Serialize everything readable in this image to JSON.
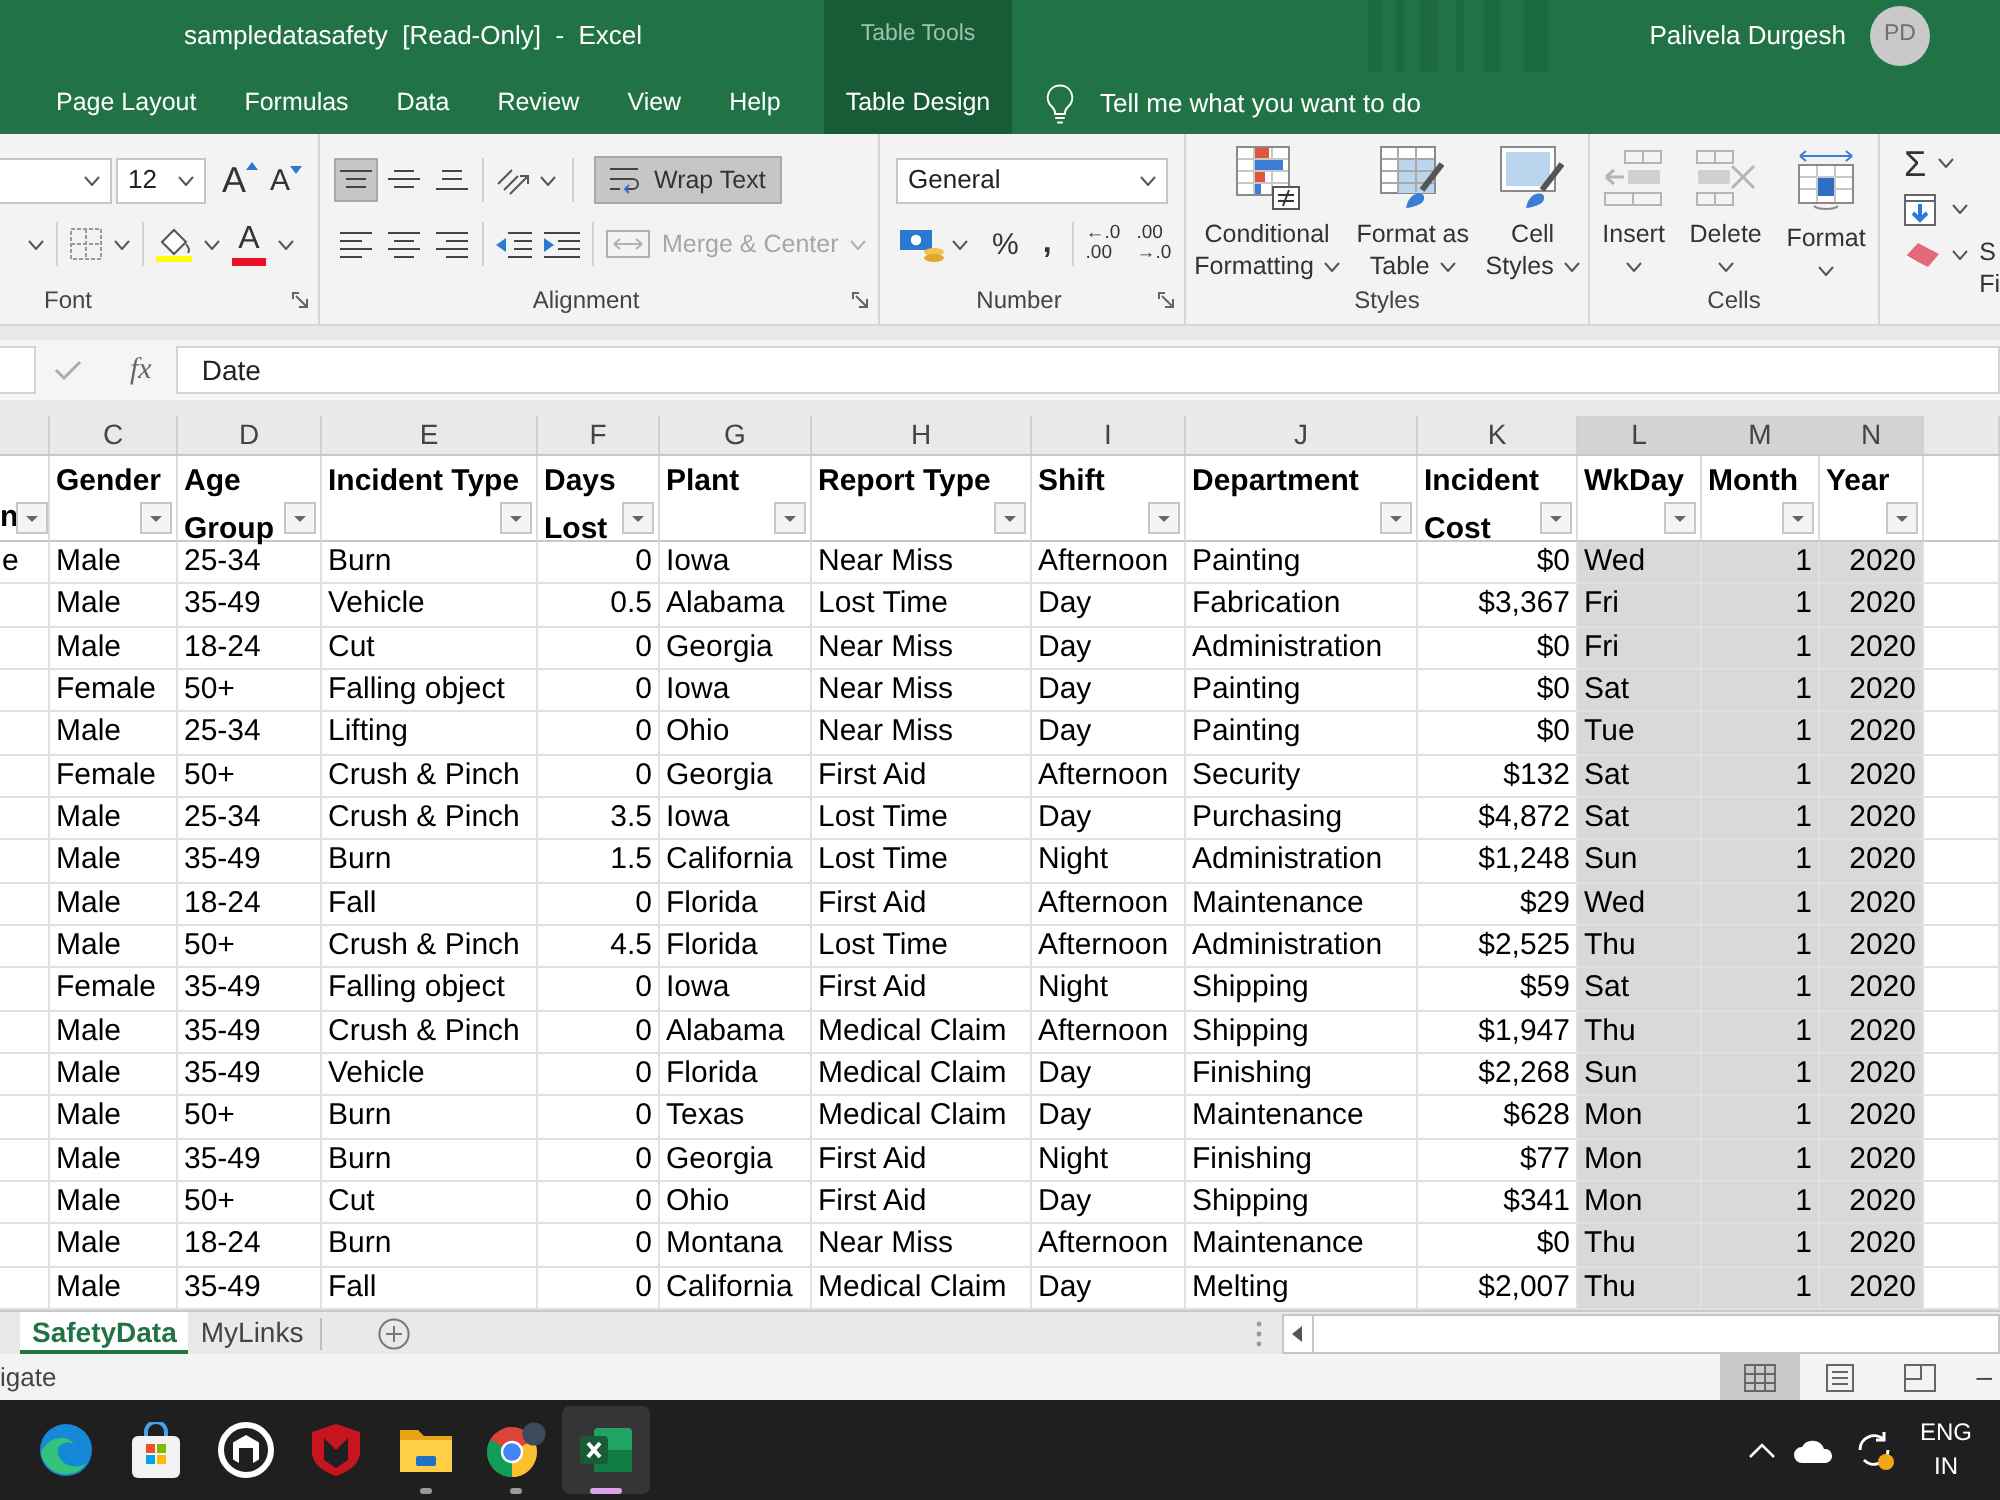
{
  "window": {
    "title": "sampledatasafety  [Read-Only]  -  Excel",
    "context_group": "Table Tools",
    "user_name": "Palivela Durgesh",
    "user_initials": "PD"
  },
  "ribbon_tabs": [
    {
      "label": "Page Layout",
      "selected": false,
      "kind": "standard"
    },
    {
      "label": "Formulas",
      "selected": false,
      "kind": "standard"
    },
    {
      "label": "Data",
      "selected": false,
      "kind": "standard"
    },
    {
      "label": "Review",
      "selected": false,
      "kind": "standard"
    },
    {
      "label": "View",
      "selected": false,
      "kind": "standard"
    },
    {
      "label": "Help",
      "selected": false,
      "kind": "standard"
    },
    {
      "label": "Table Design",
      "selected": false,
      "kind": "contextual"
    }
  ],
  "tell_me": {
    "placeholder": "Tell me what you want to do"
  },
  "font_group": {
    "label": "Font",
    "font_size": "12",
    "grow_font": "A",
    "shrink_font": "A",
    "font_color": "A"
  },
  "alignment_group": {
    "label": "Alignment",
    "vertical_align": [
      {
        "kind": "top",
        "selected": true
      },
      {
        "kind": "middle",
        "selected": false
      },
      {
        "kind": "bottom",
        "selected": false
      }
    ],
    "wrap_text": {
      "label": "Wrap Text",
      "on": true
    },
    "merge_center": {
      "label": "Merge & Center",
      "disabled": true
    }
  },
  "number_group": {
    "label": "Number",
    "format": "General",
    "percent": "%",
    "comma": ",",
    "increase_decimal": [
      "←.0",
      ".00"
    ],
    "decrease_decimal": [
      ".00",
      "→.0"
    ]
  },
  "styles_group": {
    "label": "Styles",
    "buttons": [
      {
        "kind": "conditional",
        "lines": [
          "Conditional",
          "Formatting"
        ]
      },
      {
        "kind": "table",
        "lines": [
          "Format as",
          "Table"
        ]
      },
      {
        "kind": "cell_styles",
        "lines": [
          "Cell",
          "Styles"
        ]
      }
    ]
  },
  "cells_group": {
    "label": "Cells",
    "buttons": [
      {
        "kind": "insert",
        "label": "Insert"
      },
      {
        "kind": "delete",
        "label": "Delete"
      },
      {
        "kind": "format",
        "label": "Format"
      }
    ]
  },
  "editing_group": {
    "autosum": "Σ",
    "cut_labels": [
      "S",
      "Fi"
    ]
  },
  "formula_bar": {
    "insert_function": "fx",
    "value": "Date"
  },
  "sheet": {
    "partial_column": {
      "header": "n",
      "cells": [
        "e"
      ]
    },
    "columns": [
      {
        "letter": "C",
        "header": "Gender",
        "kind": "text",
        "selected": false
      },
      {
        "letter": "D",
        "header": "Age Group",
        "kind": "text",
        "selected": false
      },
      {
        "letter": "E",
        "header": "Incident Type",
        "kind": "text",
        "selected": false
      },
      {
        "letter": "F",
        "header": "Days Lost",
        "kind": "number",
        "selected": false
      },
      {
        "letter": "G",
        "header": "Plant",
        "kind": "text",
        "selected": false
      },
      {
        "letter": "H",
        "header": "Report Type",
        "kind": "text",
        "selected": false
      },
      {
        "letter": "I",
        "header": "Shift",
        "kind": "text",
        "selected": false
      },
      {
        "letter": "J",
        "header": "Department",
        "kind": "text",
        "selected": false
      },
      {
        "letter": "K",
        "header": "Incident Cost",
        "kind": "number",
        "selected": false
      },
      {
        "letter": "L",
        "header": "WkDay",
        "kind": "text",
        "selected": true
      },
      {
        "letter": "M",
        "header": "Month",
        "kind": "number",
        "selected": true
      },
      {
        "letter": "N",
        "header": "Year",
        "kind": "number",
        "selected": true
      }
    ],
    "rows": [
      [
        "Male",
        "25-34",
        "Burn",
        "0",
        "Iowa",
        "Near Miss",
        "Afternoon",
        "Painting",
        "$0",
        "Wed",
        "1",
        "2020"
      ],
      [
        "Male",
        "35-49",
        "Vehicle",
        "0.5",
        "Alabama",
        "Lost Time",
        "Day",
        "Fabrication",
        "$3,367",
        "Fri",
        "1",
        "2020"
      ],
      [
        "Male",
        "18-24",
        "Cut",
        "0",
        "Georgia",
        "Near Miss",
        "Day",
        "Administration",
        "$0",
        "Fri",
        "1",
        "2020"
      ],
      [
        "Female",
        "50+",
        "Falling object",
        "0",
        "Iowa",
        "Near Miss",
        "Day",
        "Painting",
        "$0",
        "Sat",
        "1",
        "2020"
      ],
      [
        "Male",
        "25-34",
        "Lifting",
        "0",
        "Ohio",
        "Near Miss",
        "Day",
        "Painting",
        "$0",
        "Tue",
        "1",
        "2020"
      ],
      [
        "Female",
        "50+",
        "Crush & Pinch",
        "0",
        "Georgia",
        "First Aid",
        "Afternoon",
        "Security",
        "$132",
        "Sat",
        "1",
        "2020"
      ],
      [
        "Male",
        "25-34",
        "Crush & Pinch",
        "3.5",
        "Iowa",
        "Lost Time",
        "Day",
        "Purchasing",
        "$4,872",
        "Sat",
        "1",
        "2020"
      ],
      [
        "Male",
        "35-49",
        "Burn",
        "1.5",
        "California",
        "Lost Time",
        "Night",
        "Administration",
        "$1,248",
        "Sun",
        "1",
        "2020"
      ],
      [
        "Male",
        "18-24",
        "Fall",
        "0",
        "Florida",
        "First Aid",
        "Afternoon",
        "Maintenance",
        "$29",
        "Wed",
        "1",
        "2020"
      ],
      [
        "Male",
        "50+",
        "Crush & Pinch",
        "4.5",
        "Florida",
        "Lost Time",
        "Afternoon",
        "Administration",
        "$2,525",
        "Thu",
        "1",
        "2020"
      ],
      [
        "Female",
        "35-49",
        "Falling object",
        "0",
        "Iowa",
        "First Aid",
        "Night",
        "Shipping",
        "$59",
        "Sat",
        "1",
        "2020"
      ],
      [
        "Male",
        "35-49",
        "Crush & Pinch",
        "0",
        "Alabama",
        "Medical Claim",
        "Afternoon",
        "Shipping",
        "$1,947",
        "Thu",
        "1",
        "2020"
      ],
      [
        "Male",
        "35-49",
        "Vehicle",
        "0",
        "Florida",
        "Medical Claim",
        "Day",
        "Finishing",
        "$2,268",
        "Sun",
        "1",
        "2020"
      ],
      [
        "Male",
        "50+",
        "Burn",
        "0",
        "Texas",
        "Medical Claim",
        "Day",
        "Maintenance",
        "$628",
        "Mon",
        "1",
        "2020"
      ],
      [
        "Male",
        "35-49",
        "Burn",
        "0",
        "Georgia",
        "First Aid",
        "Night",
        "Finishing",
        "$77",
        "Mon",
        "1",
        "2020"
      ],
      [
        "Male",
        "50+",
        "Cut",
        "0",
        "Ohio",
        "First Aid",
        "Day",
        "Shipping",
        "$341",
        "Mon",
        "1",
        "2020"
      ],
      [
        "Male",
        "18-24",
        "Burn",
        "0",
        "Montana",
        "Near Miss",
        "Afternoon",
        "Maintenance",
        "$0",
        "Thu",
        "1",
        "2020"
      ],
      [
        "Male",
        "35-49",
        "Fall",
        "0",
        "California",
        "Medical Claim",
        "Day",
        "Melting",
        "$2,007",
        "Thu",
        "1",
        "2020"
      ]
    ]
  },
  "sheet_tabs": [
    {
      "label": "SafetyData",
      "selected": true
    },
    {
      "label": "MyLinks",
      "selected": false
    }
  ],
  "status_bar": {
    "text": "igate",
    "views": [
      {
        "kind": "normal",
        "selected": true
      },
      {
        "kind": "page_layout",
        "selected": false
      },
      {
        "kind": "page_break",
        "selected": false
      }
    ],
    "zoom_out": "–"
  },
  "taskbar": {
    "apps": [
      {
        "kind": "edge",
        "running": false,
        "selected": false
      },
      {
        "kind": "store",
        "running": false,
        "selected": false
      },
      {
        "kind": "hexagon",
        "running": false,
        "selected": false
      },
      {
        "kind": "shield",
        "running": false,
        "selected": false
      },
      {
        "kind": "folder",
        "running": true,
        "selected": false
      },
      {
        "kind": "chrome",
        "running": true,
        "selected": false
      },
      {
        "kind": "excel",
        "running": true,
        "selected": true
      }
    ],
    "language": [
      "ENG",
      "IN"
    ]
  }
}
